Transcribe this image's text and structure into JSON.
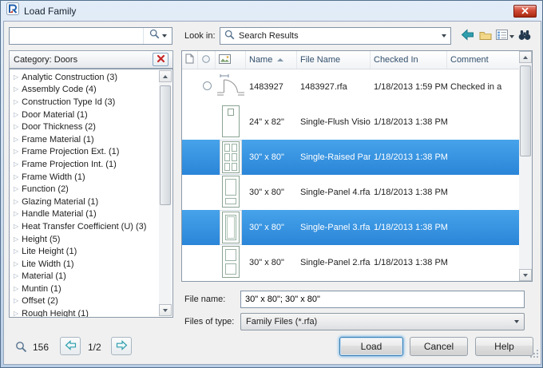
{
  "window": {
    "title": "Load Family"
  },
  "toolbar": {
    "search_value": "",
    "look_in_label": "Look in:",
    "look_in_value": "Search Results"
  },
  "category": {
    "header": "Category: Doors",
    "items": [
      "Analytic Construction (3)",
      "Assembly Code (4)",
      "Construction Type Id (3)",
      "Door Material (1)",
      "Door Thickness (2)",
      "Frame Material (1)",
      "Frame Projection Ext. (1)",
      "Frame Projection Int. (1)",
      "Frame Width (1)",
      "Function (2)",
      "Glazing Material (1)",
      "Handle Material (1)",
      "Heat Transfer Coefficient (U) (3)",
      "Height (5)",
      "Lite Height (1)",
      "Lite Width (1)",
      "Material (1)",
      "Muntin (1)",
      "Offset (2)",
      "Rough Height (1)"
    ]
  },
  "pager": {
    "count": "156",
    "page": "1/2"
  },
  "table": {
    "headers": {
      "name": "Name",
      "file_name": "File Name",
      "checked_in": "Checked In",
      "comment": "Comment"
    },
    "rows": [
      {
        "name": "1483927",
        "file_name": "1483927.rfa",
        "checked_in": "1/18/2013 1:59 PM",
        "comment": "Checked in a",
        "selected": false
      },
      {
        "name": "24\" x 82\"",
        "file_name": "Single-Flush Vision.rfa",
        "checked_in": "1/18/2013 1:38 PM",
        "comment": "",
        "selected": false
      },
      {
        "name": "30\" x 80\"",
        "file_name": "Single-Raised Panel w...",
        "checked_in": "1/18/2013 1:38 PM",
        "comment": "",
        "selected": true
      },
      {
        "name": "30\" x 80\"",
        "file_name": "Single-Panel 4.rfa",
        "checked_in": "1/18/2013 1:38 PM",
        "comment": "",
        "selected": false
      },
      {
        "name": "30\" x 80\"",
        "file_name": "Single-Panel 3.rfa",
        "checked_in": "1/18/2013 1:38 PM",
        "comment": "",
        "selected": true
      },
      {
        "name": "30\" x 80\"",
        "file_name": "Single-Panel 2.rfa",
        "checked_in": "1/18/2013 1:38 PM",
        "comment": "",
        "selected": false
      }
    ]
  },
  "footer": {
    "file_name_label": "File name:",
    "file_name_value": "30\" x 80\"; 30\" x 80\"",
    "files_of_type_label": "Files of type:",
    "files_of_type_value": "Family Files (*.rfa)"
  },
  "buttons": {
    "load": "Load",
    "cancel": "Cancel",
    "help": "Help"
  },
  "icons": {
    "app-icon": "revit-logo",
    "close-icon": "x",
    "search-icon": "magnifier",
    "back-icon": "teal-left-arrow",
    "up-folder-icon": "folder",
    "views-icon": "list-view",
    "find-icon": "binoculars",
    "clear-category-icon": "red-x",
    "expand-icon": "hollow-right-triangle",
    "prev-icon": "teal-left-arrow",
    "next-icon": "teal-right-arrow",
    "sort-ascending-icon": "up-triangle",
    "document-icon": "page",
    "status-icon": "circle",
    "image-icon": "picture"
  },
  "colors": {
    "selection": "#2f8dda",
    "titlebar_top": "#e3edf8",
    "titlebar_bottom": "#b9cde4",
    "accent_red": "#c62828",
    "accent_teal": "#2f9fae"
  }
}
